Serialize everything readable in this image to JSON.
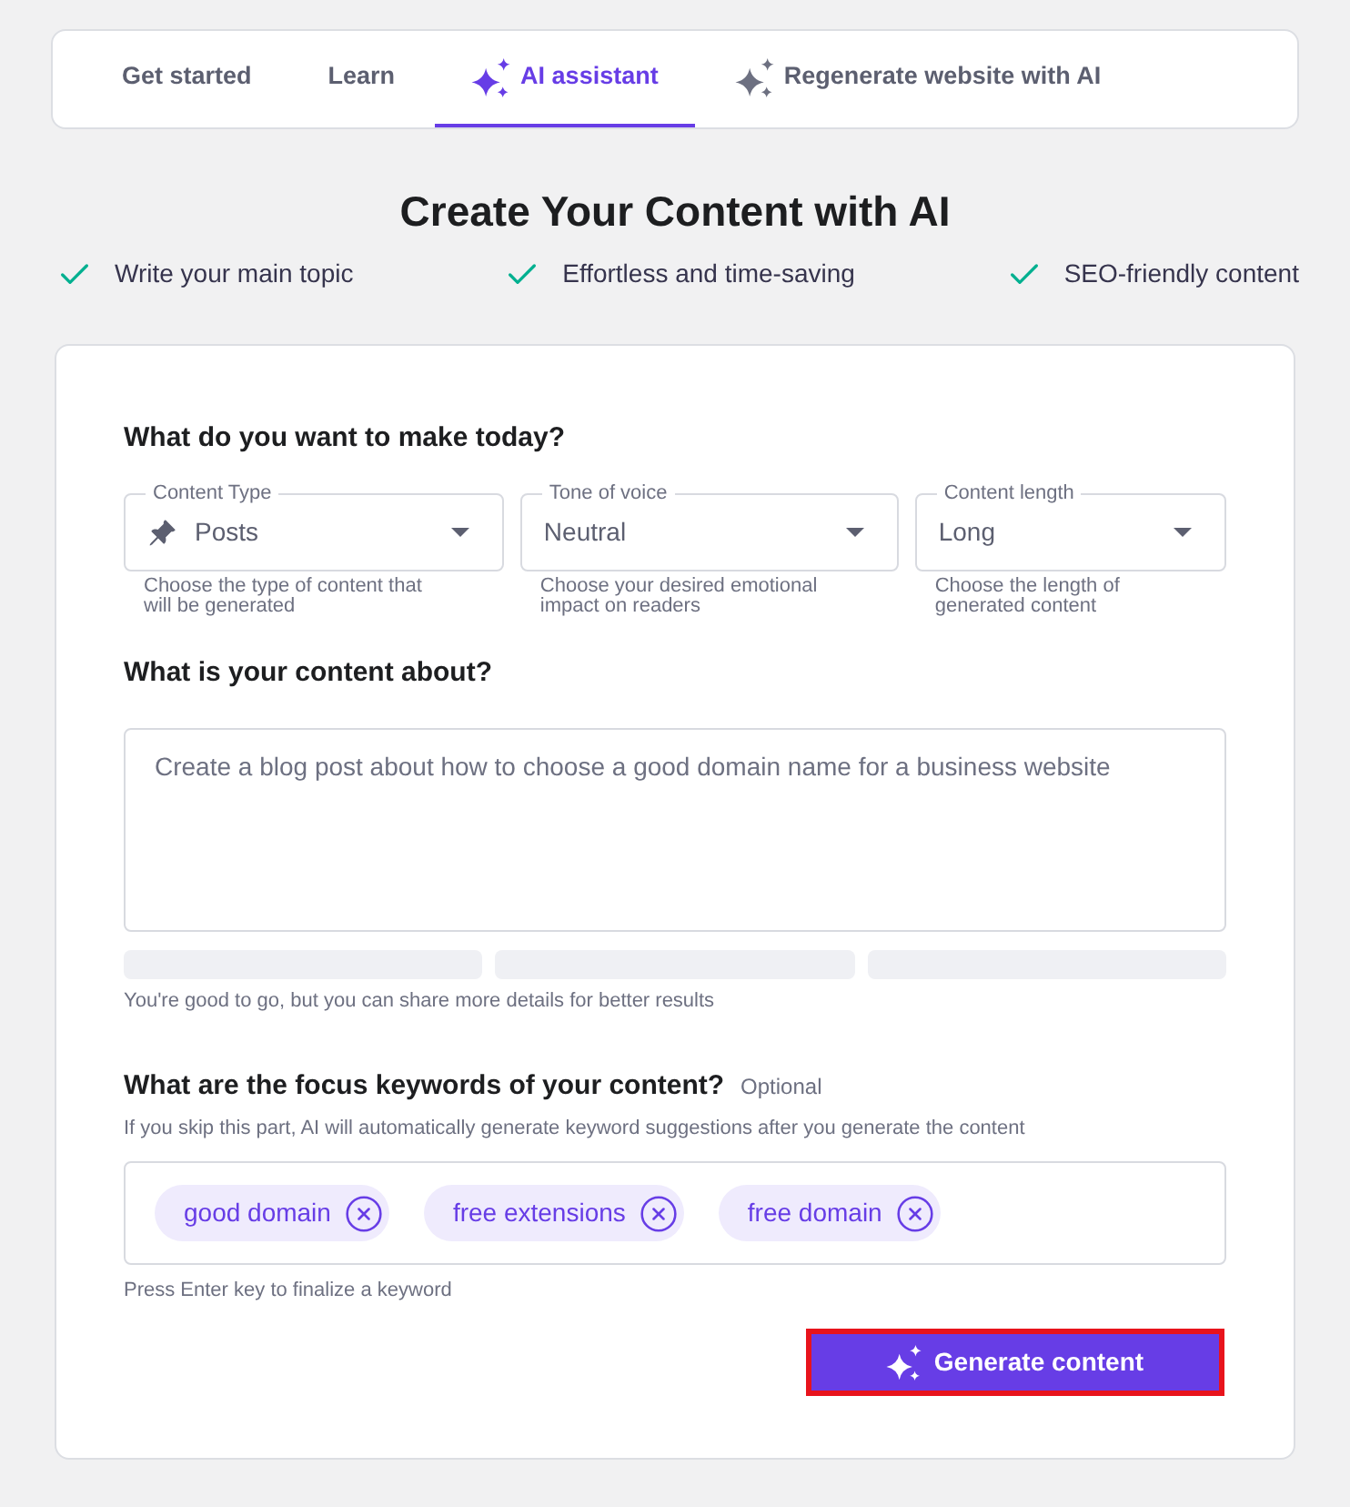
{
  "tabs": [
    {
      "label": "Get started",
      "kind": "text",
      "selected": false
    },
    {
      "label": "Learn",
      "kind": "text",
      "selected": false
    },
    {
      "label": "AI assistant",
      "kind": "ai",
      "selected": true
    },
    {
      "label": "Regenerate website with AI",
      "kind": "ai",
      "selected": false
    }
  ],
  "heading": "Create Your Content with AI",
  "features": [
    "Write your main topic",
    "Effortless and time-saving",
    "SEO-friendly content"
  ],
  "form": {
    "make_title": "What do you want to make today?",
    "selects": [
      {
        "label": "Content Type",
        "value": "Posts",
        "kind": "with_icon",
        "hint": "Choose the type of content that will be generated"
      },
      {
        "label": "Tone of voice",
        "value": "Neutral",
        "kind": "plain",
        "hint": "Choose your desired emotional impact on readers"
      },
      {
        "label": "Content length",
        "value": "Long",
        "kind": "plain",
        "hint": "Choose the length of generated content"
      }
    ],
    "topic": {
      "title": "What is your content about?",
      "value": "Create a blog post about how to choose a good domain name for a business website",
      "hint": "You're good to go, but you can share more details for better results"
    },
    "keywords": {
      "title": "What are the focus keywords of your content?",
      "optional": "Optional",
      "hint": "If you skip this part, AI will automatically generate keyword suggestions after you generate the content",
      "chips": [
        "good domain",
        "free extensions",
        "free domain"
      ],
      "footer": "Press Enter key to finalize a keyword"
    },
    "generate_button": {
      "label": "Generate content",
      "highlighted": true
    }
  }
}
